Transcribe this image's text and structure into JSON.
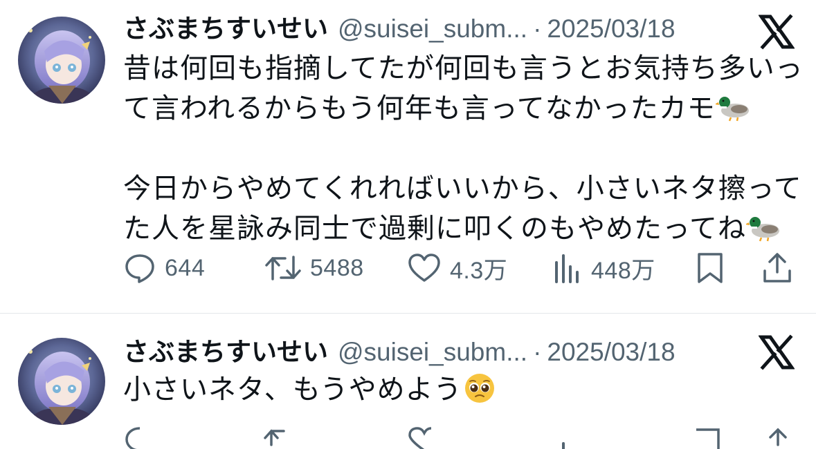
{
  "tweets": [
    {
      "display_name": "さぶまちすいせい",
      "handle": "@suisei_subm...",
      "separator": "·",
      "date": "2025/03/18",
      "text_lines": [
        "昔は何回も指摘してたが何回も言うとお気持ち多いっ",
        "て言われるからもう何年も言ってなかったカモ",
        "",
        "今日からやめてくれればいいから、小さいネタ擦って",
        "た人を星詠み同士で過剰に叩くのもやめたってね"
      ],
      "emoji_after_lines": [
        "duck",
        "duck"
      ],
      "actions": {
        "replies": "644",
        "retweets": "5488",
        "likes": "4.3万",
        "views": "448万"
      }
    },
    {
      "display_name": "さぶまちすいせい",
      "handle": "@suisei_subm...",
      "separator": "·",
      "date": "2025/03/18",
      "text_lines": [
        "小さいネタ、もうやめよう"
      ],
      "emoji": "pleading-face"
    }
  ],
  "icons": {
    "logo": "x-logo-icon",
    "reply": "speech-bubble-icon",
    "retweet": "retweet-arrows-icon",
    "like": "heart-icon",
    "views": "bar-chart-icon",
    "bookmark": "bookmark-icon",
    "share": "share-icon"
  },
  "colors": {
    "text": "#0f1419",
    "secondary": "#536471",
    "divider": "#e3e7ea"
  }
}
